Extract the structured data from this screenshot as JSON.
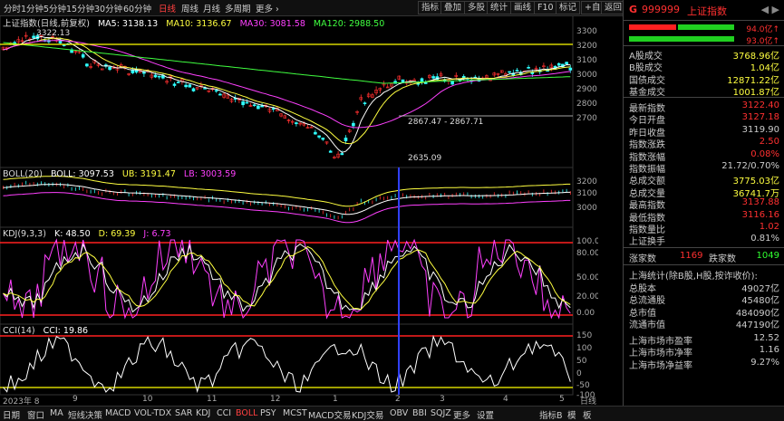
{
  "topbar": {
    "periods": [
      {
        "label": "分时",
        "active": false
      },
      {
        "label": "1分钟",
        "active": false
      },
      {
        "label": "5分钟",
        "active": false
      },
      {
        "label": "15分钟",
        "active": false
      },
      {
        "label": "30分钟",
        "active": false
      },
      {
        "label": "60分钟",
        "active": false
      },
      {
        "label": "日线",
        "active": true
      },
      {
        "label": "周线",
        "active": false
      },
      {
        "label": "月线",
        "active": false
      },
      {
        "label": "多周期",
        "active": false
      },
      {
        "label": "更多 ›",
        "active": false
      }
    ],
    "buttons": [
      "指标",
      "叠加",
      "多股",
      "统计",
      "画线",
      "F10",
      "标记",
      "+自选",
      "返回"
    ]
  },
  "main_panel": {
    "title": "上证指数(日线,前复权)",
    "ma5": "MA5: 3138.13",
    "ma10": "MA10: 3136.67",
    "ma30": "MA30: 3081.58",
    "ma120": "MA120: 2988.50",
    "hi_label": "3322.13",
    "lo_label": "2635.09",
    "mid_label": "2867.47 - 2867.71",
    "y_ticks": [
      "3300",
      "3200",
      "3100",
      "3000",
      "2900",
      "2800",
      "2700"
    ]
  },
  "boll_panel": {
    "title": "BOLL(20)",
    "boll": "BOLL: 3097.53",
    "ub": "UB: 3191.47",
    "lb": "LB: 3003.59",
    "y_ticks": [
      "3200",
      "3100",
      "3000"
    ]
  },
  "kdj_panel": {
    "title": "KDJ(9,3,3)",
    "k": "K: 48.50",
    "d": "D: 69.39",
    "j": "J: 6.73",
    "y_ticks": [
      "100.00",
      "80.00",
      "50.00",
      "20.00",
      "0.00"
    ]
  },
  "cci_panel": {
    "title": "CCI(14)",
    "cci": "CCI: 19.86",
    "y_ticks": [
      "150",
      "100",
      "50",
      "0",
      "-50",
      "-100"
    ]
  },
  "date_axis": [
    "2023年 8",
    "9",
    "10",
    "11",
    "12",
    "1",
    "2",
    "3",
    "4",
    "5"
  ],
  "date_axis_right": "日线",
  "bottombar": {
    "items": [
      "日期",
      "窗口",
      "MA",
      "短线决策",
      "MACD",
      "VOL-TDX",
      "SAR",
      "KDJ",
      "CCI",
      "BOLL",
      "PSY",
      "MCST",
      "MACD交易",
      "KDJ交易",
      "OBV",
      "BBI",
      "SQJZ",
      "更多",
      "设置"
    ],
    "active": "BOLL",
    "right": [
      "指标B",
      "模",
      "板"
    ]
  },
  "quote": {
    "g": "G",
    "code": "999999",
    "name": "上证指数",
    "ctrl": "◀ ▶",
    "bar1_val": "94.0亿↑",
    "bar2_val": "93.0亿↑",
    "rows1": [
      {
        "label": "A股成交",
        "value": "3768.96亿",
        "color": "#ffff40"
      },
      {
        "label": "B股成交",
        "value": "1.04亿",
        "color": "#ffff40"
      },
      {
        "label": "国债成交",
        "value": "12871.22亿",
        "color": "#ffff40"
      },
      {
        "label": "基金成交",
        "value": "1001.87亿",
        "color": "#ffff40"
      }
    ],
    "rows2": [
      {
        "label": "最新指数",
        "value": "3122.40",
        "color": "#ff3030"
      },
      {
        "label": "今日开盘",
        "value": "3127.18",
        "color": "#ff3030"
      },
      {
        "label": "昨日收盘",
        "value": "3119.90",
        "color": "#cccccc"
      },
      {
        "label": "指数涨跌",
        "value": "2.50",
        "color": "#ff3030"
      },
      {
        "label": "指数涨幅",
        "value": "0.08%",
        "color": "#ff3030"
      },
      {
        "label": "指数振幅",
        "value": "21.72/0.70%",
        "color": "#cccccc"
      },
      {
        "label": "总成交额",
        "value": "3775.03亿",
        "color": "#ffff40"
      },
      {
        "label": "总成交量",
        "value": "36741.7万",
        "color": "#ffff40"
      },
      {
        "label": "最高指数",
        "value": "3137.88",
        "color": "#ff3030"
      },
      {
        "label": "最低指数",
        "value": "3116.16",
        "color": "#ff3030"
      },
      {
        "label": "指数量比",
        "value": "1.02",
        "color": "#ff3030"
      },
      {
        "label": "上证换手",
        "value": "0.81%",
        "color": "#cccccc"
      }
    ],
    "updown": {
      "up_label": "涨家数",
      "up_value": "1169",
      "down_label": "跌家数",
      "down_value": "1049"
    },
    "stats_title": "上海统计(除B股,H股,按诈收价):",
    "rows3": [
      {
        "label": "总股本",
        "value": "49027亿"
      },
      {
        "label": "总流通股",
        "value": "45480亿"
      },
      {
        "label": "总市值",
        "value": "484090亿"
      },
      {
        "label": "流通市值",
        "value": "447190亿"
      }
    ],
    "rows4": [
      {
        "label": "上海市场市盈率",
        "value": "12.52"
      },
      {
        "label": "上海市场市净率",
        "value": "1.16"
      },
      {
        "label": "上海市场净益率",
        "value": "9.27%"
      }
    ]
  },
  "colors": {
    "up": "#ff3030",
    "down": "#30ffff",
    "ma5": "#ffffff",
    "ma10": "#ffff40",
    "ma30": "#ff40ff",
    "ma120": "#40ff40",
    "refline": "#ffff00",
    "redline": "#ff2020",
    "blueline": "#3040ff"
  }
}
